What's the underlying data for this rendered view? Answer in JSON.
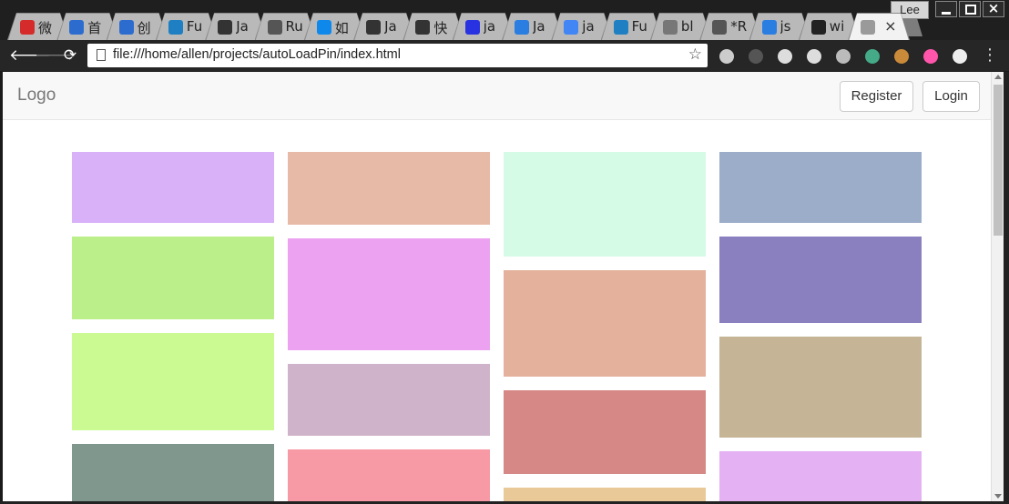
{
  "browser": {
    "tabs": [
      {
        "label": "微",
        "icon": "weibo-icon",
        "color": "#d52c2b"
      },
      {
        "label": "首",
        "icon": "rocket-icon",
        "color": "#2d6ccf"
      },
      {
        "label": "创",
        "icon": "rocket-icon",
        "color": "#2d6ccf"
      },
      {
        "label": "Fu",
        "icon": "cloud-icon",
        "color": "#1e7fc2"
      },
      {
        "label": "Ja",
        "icon": "book-icon",
        "color": "#333333"
      },
      {
        "label": "Ru",
        "icon": "r-icon",
        "color": "#555555"
      },
      {
        "label": "如",
        "icon": "zhihu-icon",
        "color": "#0f88eb"
      },
      {
        "label": "Ja",
        "icon": "book-icon",
        "color": "#333333"
      },
      {
        "label": "快",
        "icon": "book-icon",
        "color": "#333333"
      },
      {
        "label": "ja",
        "icon": "baidu-icon",
        "color": "#2932e1"
      },
      {
        "label": "Ja",
        "icon": "translate-icon",
        "color": "#2a7de1"
      },
      {
        "label": "ja",
        "icon": "google-icon",
        "color": "#4285f4"
      },
      {
        "label": "Fu",
        "icon": "cloud-icon",
        "color": "#1e7fc2"
      },
      {
        "label": "bl",
        "icon": "page-icon",
        "color": "#777777"
      },
      {
        "label": "*R",
        "icon": "r-icon",
        "color": "#555555"
      },
      {
        "label": "js",
        "icon": "translate-icon",
        "color": "#2a7de1"
      },
      {
        "label": "wi",
        "icon": "github-icon",
        "color": "#222222"
      }
    ],
    "active_tab_close": "×",
    "profile_name": "Lee",
    "url": "file:///home/allen/projects/autoLoadPin/index.html",
    "extensions": [
      "ext-notify-icon",
      "ext-grey-icon",
      "ext-resume-icon",
      "mail-icon",
      "eyedropper-icon",
      "ext-color-ring-icon",
      "cookie-icon",
      "color-wheel-icon",
      "ext-c-icon"
    ]
  },
  "page": {
    "logo": "Logo",
    "register_label": "Register",
    "login_label": "Login"
  },
  "pins": {
    "columns": [
      [
        {
          "color": "#d8b1f9"
        },
        {
          "color": "#bbef8a"
        },
        {
          "color": "#cbfa93"
        },
        {
          "color": "#7f978d"
        }
      ],
      [
        {
          "color": "#e7b9a7"
        },
        {
          "color": "#eca1f1"
        },
        {
          "color": "#cfb3ca"
        },
        {
          "color": "#f899a6"
        }
      ],
      [
        {
          "color": "#d5fae5"
        },
        {
          "color": "#e4b19c"
        },
        {
          "color": "#d58886"
        },
        {
          "color": "#e9c998"
        }
      ],
      [
        {
          "color": "#9cadca"
        },
        {
          "color": "#8a80bf"
        },
        {
          "color": "#c5b496"
        },
        {
          "color": "#e4b2f3"
        }
      ]
    ]
  }
}
